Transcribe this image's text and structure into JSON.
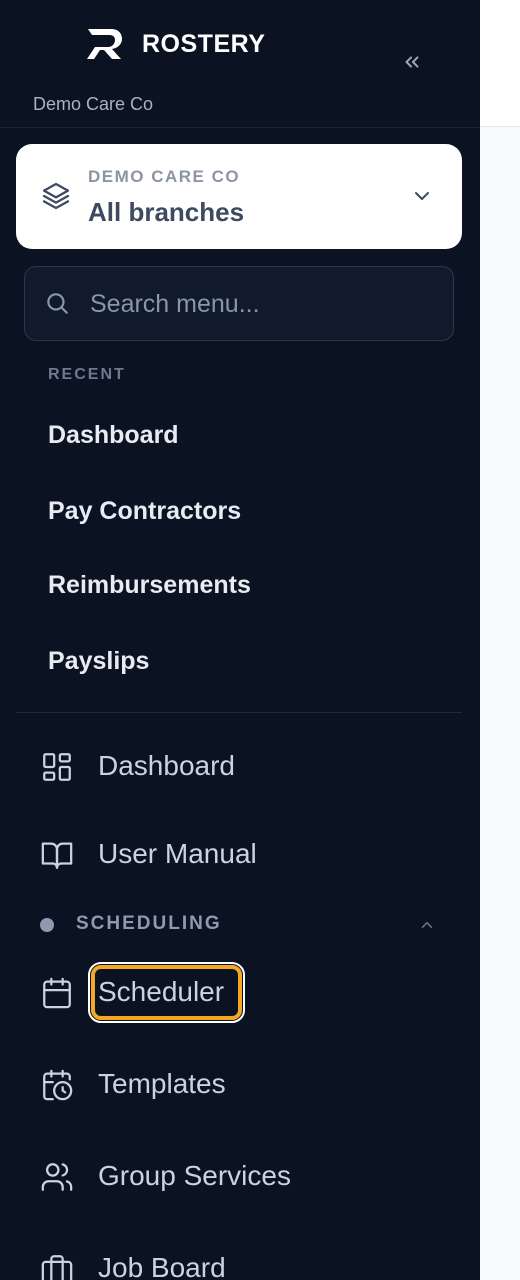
{
  "brand": {
    "name": "ROSTERY",
    "org": "Demo Care Co"
  },
  "branch_selector": {
    "kicker": "DEMO CARE CO",
    "value": "All branches"
  },
  "search": {
    "placeholder": "Search menu..."
  },
  "recent": {
    "title": "RECENT",
    "items": [
      "Dashboard",
      "Pay Contractors",
      "Reimbursements",
      "Payslips"
    ]
  },
  "nav": {
    "dashboard": "Dashboard",
    "user_manual": "User Manual"
  },
  "scheduling": {
    "title": "SCHEDULING",
    "items": [
      "Scheduler",
      "Templates",
      "Group Services",
      "Job Board"
    ]
  },
  "colors": {
    "sidebar_bg": "#0b1222",
    "focus_ring": "#f5a623",
    "card_bg": "#ffffff"
  },
  "icons": {
    "collapse": "double-chevron-left-icon",
    "branch": "layers-icon",
    "dropdown": "chevron-down-icon",
    "search": "search-icon",
    "dashboard": "grid-icon",
    "user_manual": "book-open-icon",
    "section_toggle": "chevron-up-icon",
    "scheduler": "calendar-icon",
    "templates": "calendar-clock-icon",
    "group_services": "users-icon",
    "job_board": "briefcase-icon"
  }
}
